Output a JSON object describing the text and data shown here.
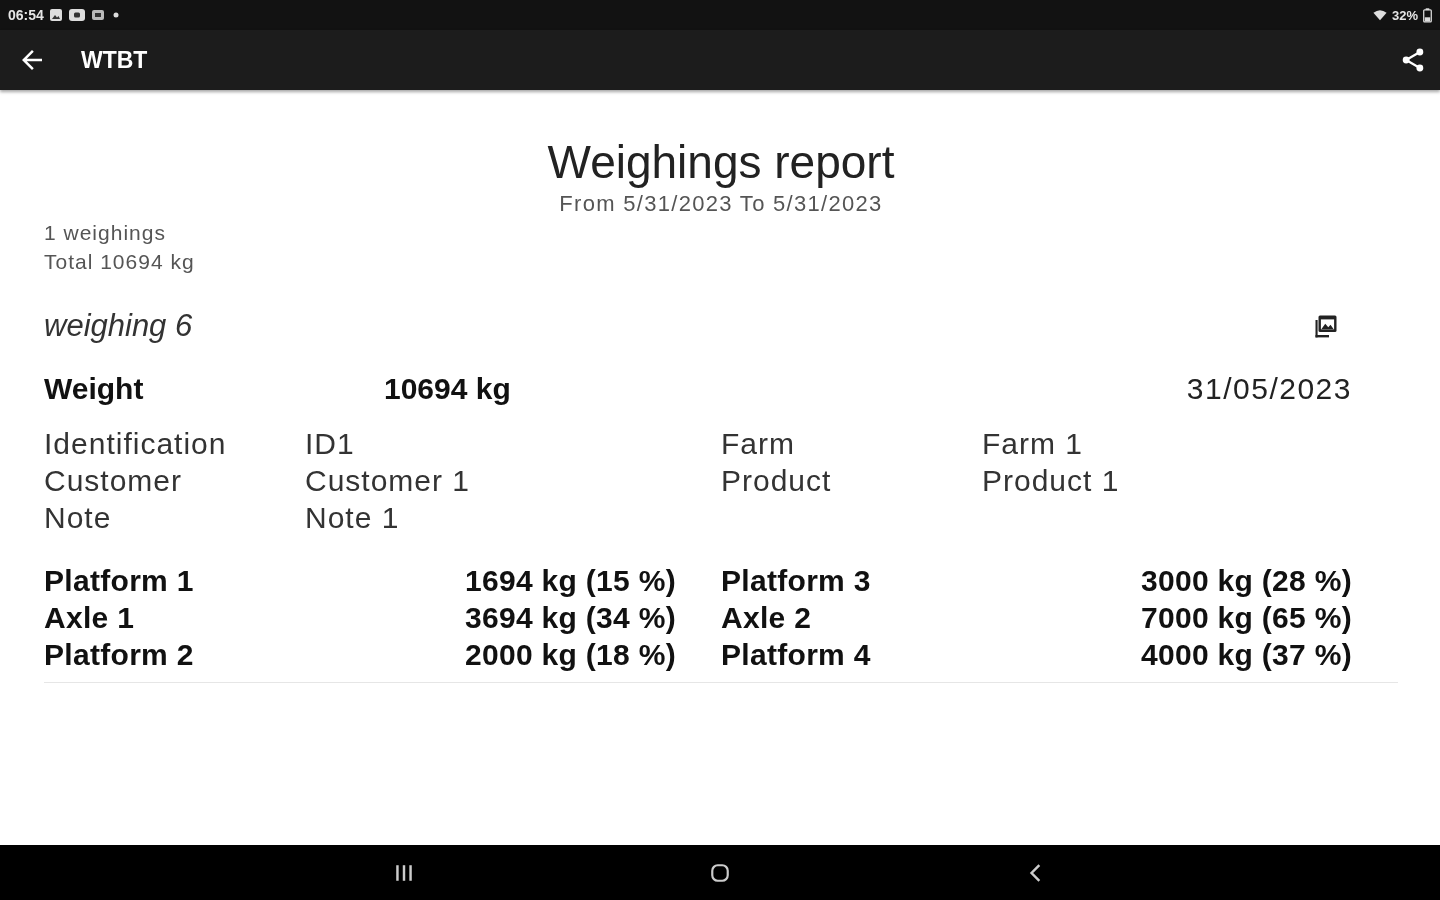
{
  "status_bar": {
    "time": "06:54",
    "battery": "32%"
  },
  "app_bar": {
    "title": "WTBT"
  },
  "report": {
    "title": "Weighings report",
    "subtitle": "From 5/31/2023 To 5/31/2023",
    "summary": [
      "1 weighings",
      "Total 10694 kg"
    ]
  },
  "weighing": {
    "name": "weighing 6",
    "weight_label": "Weight",
    "weight": "10694 kg",
    "date": "31/05/2023",
    "details": [
      {
        "label": "Identification",
        "value": "ID1"
      },
      {
        "label": "Farm",
        "value": "Farm 1"
      },
      {
        "label": "Customer",
        "value": "Customer 1"
      },
      {
        "label": "Product",
        "value": "Product 1"
      },
      {
        "label": "Note",
        "value": "Note 1"
      }
    ],
    "axle_groups": [
      [
        {
          "label": "Platform 1",
          "value": "1694 kg (15 %)"
        },
        {
          "label": "Axle 1",
          "value": "3694 kg (34 %)"
        },
        {
          "label": "Platform 2",
          "value": "2000 kg (18 %)"
        }
      ],
      [
        {
          "label": "Platform 3",
          "value": "3000 kg (28 %)"
        },
        {
          "label": "Axle 2",
          "value": "7000 kg (65 %)"
        },
        {
          "label": "Platform 4",
          "value": "4000 kg (37 %)"
        }
      ]
    ]
  }
}
